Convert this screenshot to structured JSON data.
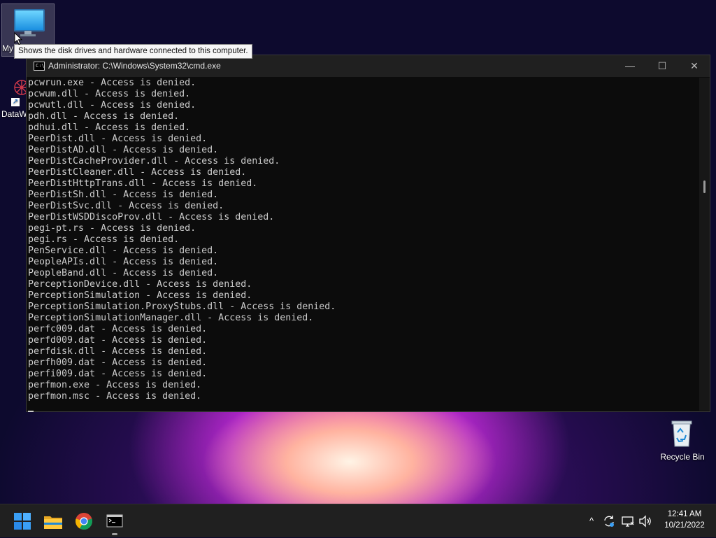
{
  "desktop": {
    "icons": [
      {
        "label": "My"
      },
      {
        "label": "DataW"
      },
      {
        "label": "Recycle Bin"
      }
    ],
    "tooltip": "Shows the disk drives and hardware connected to this computer."
  },
  "window": {
    "title": "Administrator:  C:\\Windows\\System32\\cmd.exe",
    "icon_text": "C:\\",
    "minimize_glyph": "—",
    "maximize_glyph": "☐",
    "close_glyph": "✕"
  },
  "console_lines": [
    "pcwrun.exe - Access is denied.",
    "pcwum.dll - Access is denied.",
    "pcwutl.dll - Access is denied.",
    "pdh.dll - Access is denied.",
    "pdhui.dll - Access is denied.",
    "PeerDist.dll - Access is denied.",
    "PeerDistAD.dll - Access is denied.",
    "PeerDistCacheProvider.dll - Access is denied.",
    "PeerDistCleaner.dll - Access is denied.",
    "PeerDistHttpTrans.dll - Access is denied.",
    "PeerDistSh.dll - Access is denied.",
    "PeerDistSvc.dll - Access is denied.",
    "PeerDistWSDDiscoProv.dll - Access is denied.",
    "pegi-pt.rs - Access is denied.",
    "pegi.rs - Access is denied.",
    "PenService.dll - Access is denied.",
    "PeopleAPIs.dll - Access is denied.",
    "PeopleBand.dll - Access is denied.",
    "PerceptionDevice.dll - Access is denied.",
    "PerceptionSimulation - Access is denied.",
    "PerceptionSimulation.ProxyStubs.dll - Access is denied.",
    "PerceptionSimulationManager.dll - Access is denied.",
    "perfc009.dat - Access is denied.",
    "perfd009.dat - Access is denied.",
    "perfdisk.dll - Access is denied.",
    "perfh009.dat - Access is denied.",
    "perfi009.dat - Access is denied.",
    "perfmon.exe - Access is denied.",
    "perfmon.msc - Access is denied."
  ],
  "taskbar": {
    "tray_chevron": "^",
    "time": "12:41 AM",
    "date": "10/21/2022"
  },
  "colors": {
    "console_bg": "#0c0c0c",
    "console_text": "#cccccc",
    "titlebar_bg": "#202020",
    "taskbar_bg": "#202020",
    "start_blue": "#3a9ff5"
  }
}
